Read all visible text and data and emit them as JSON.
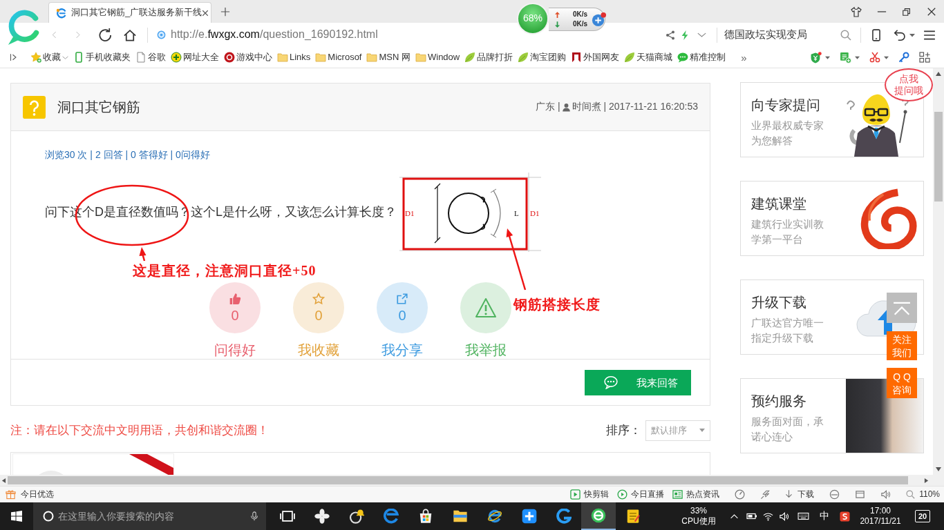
{
  "browser": {
    "tabs": [
      {
        "title": "洞口其它钢筋_广联达服务新干线",
        "selected": true
      }
    ],
    "network": {
      "percent": "68%",
      "upload": "0K/s",
      "download": "0K/s"
    },
    "address": {
      "scheme": "http://e.",
      "domain": "fwxgx.com",
      "path": "/question_1690192.html"
    },
    "search": {
      "value": "德国政坛实现变局"
    }
  },
  "bookmarks": {
    "items": [
      {
        "label": "收藏",
        "kind": "favorites"
      },
      {
        "label": "手机收藏夹",
        "kind": "phone"
      },
      {
        "label": "谷歌",
        "kind": "page"
      },
      {
        "label": "网址大全",
        "kind": "navigation"
      },
      {
        "label": "游戏中心",
        "kind": "game"
      },
      {
        "label": "Links",
        "kind": "folder"
      },
      {
        "label": "Microsof",
        "kind": "folder"
      },
      {
        "label": "MSN 网",
        "kind": "folder"
      },
      {
        "label": "Window",
        "kind": "folder"
      },
      {
        "label": "品牌打折",
        "kind": "leaf"
      },
      {
        "label": "淘宝团购",
        "kind": "leaf"
      },
      {
        "label": "外国网友",
        "kind": "flag"
      },
      {
        "label": "天猫商城",
        "kind": "leaf"
      },
      {
        "label": "精准控制",
        "kind": "chat"
      }
    ],
    "more": "»"
  },
  "question": {
    "title": "洞口其它钢筋",
    "region": "广东 |",
    "author_time": "时间煮 | 2017-11-21 16:20:53",
    "stats": "浏览30 次 | 2 回答 | 0 答得好 | 0问得好",
    "text": "问下这个D是直径数值吗？这个L是什么呀，又该怎么计算长度？",
    "figure_labels": [
      "D1",
      "L",
      "D1"
    ]
  },
  "actions": [
    {
      "kind": "good",
      "count": "0",
      "label": "问得好",
      "color": "#e8606e"
    },
    {
      "kind": "favorite",
      "count": "0",
      "label": "我收藏",
      "color": "#e2a23b"
    },
    {
      "kind": "share",
      "count": "0",
      "label": "我分享",
      "color": "#3d9be0"
    },
    {
      "kind": "report",
      "label": "我举报",
      "color": "#4fb35f"
    }
  ],
  "answer_button": "我来回答",
  "notice": "注：请在以下交流中文明用语，共创和谐交流圈！",
  "sort": {
    "label": "排序：",
    "value": "默认排序"
  },
  "annotations": [
    {
      "kind": "diameter",
      "text": "这是直径，注意洞口直径+50"
    },
    {
      "kind": "lap",
      "text": "钢筋搭接长度"
    }
  ],
  "sidebar": {
    "cards": [
      {
        "kind": "expert",
        "title": "向专家提问",
        "subtitle": "业界最权威专家为您解答"
      },
      {
        "kind": "course",
        "title": "建筑课堂",
        "subtitle": "建筑行业实训教学第一平台"
      },
      {
        "kind": "download",
        "title": "升级下载",
        "subtitle": "广联达官方唯一指定升级下载"
      },
      {
        "kind": "service",
        "title": "预约服务",
        "subtitle": "服务面对面，承诺心连心"
      }
    ],
    "bubble": [
      "点我",
      "提问哦"
    ]
  },
  "float_buttons": [
    {
      "kind": "top"
    },
    {
      "kind": "follow",
      "lines": [
        "关注",
        "我们"
      ]
    },
    {
      "kind": "qq",
      "lines": [
        "Q Q",
        "咨询"
      ]
    }
  ],
  "status_bar": {
    "left": "今日优选",
    "items": [
      {
        "kind": "clip",
        "label": "快剪辑"
      },
      {
        "kind": "live",
        "label": "今日直播"
      },
      {
        "kind": "news",
        "label": "热点资讯"
      }
    ],
    "download": "下载",
    "zoom": "110%"
  },
  "taskbar": {
    "search_placeholder": "在这里输入你要搜索的内容",
    "apps": [
      {
        "kind": "taskview",
        "active": false
      },
      {
        "kind": "pinwheel",
        "active": false
      },
      {
        "kind": "ring",
        "active": false
      },
      {
        "kind": "edge",
        "active": false
      },
      {
        "kind": "store",
        "active": false
      },
      {
        "kind": "folder",
        "active": false
      },
      {
        "kind": "ie",
        "active": false
      },
      {
        "kind": "plus",
        "active": false
      },
      {
        "kind": "swirl",
        "active": false
      },
      {
        "kind": "browser",
        "active": true
      },
      {
        "kind": "notepad",
        "active": false
      }
    ],
    "cpu": "33%",
    "cpu_label": "CPU使用",
    "ime": "中",
    "time": "17:00",
    "date": "2017/11/21",
    "notifications": "20"
  }
}
